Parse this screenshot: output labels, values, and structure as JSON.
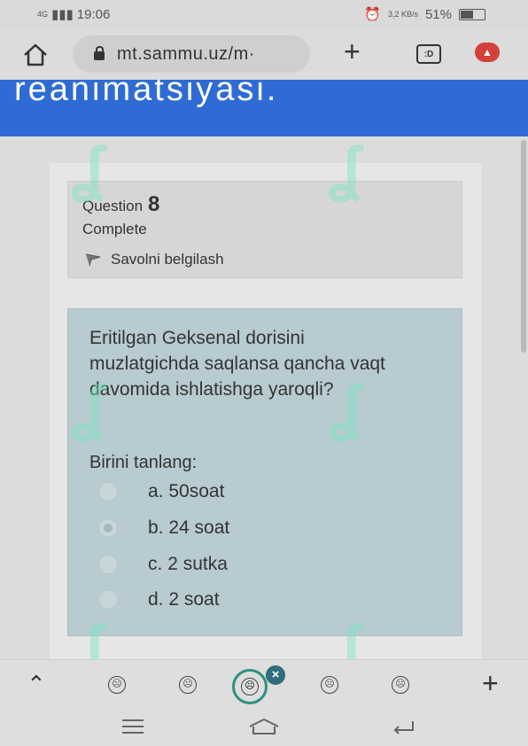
{
  "status_bar": {
    "network": "4G",
    "time": "19:06",
    "speed": "3,2 KB/s",
    "battery": "51%",
    "battery_level": 0.51
  },
  "browser": {
    "url": "mt.sammu.uz/m·",
    "tab_label": ":D"
  },
  "page": {
    "header_text": "reanimatsiyasi."
  },
  "question_info": {
    "label": "Question",
    "number": "8",
    "state": "Complete",
    "flag_label": "Savolni belgilash"
  },
  "question": {
    "text": "Eritilgan Geksenal dorisini muzlatgichda saqlansa qancha vaqt davomida ishlatishga yaroqli?",
    "choose_label": "Birini tanlang:",
    "options": [
      {
        "letter": "a.",
        "label": "50soat"
      },
      {
        "letter": "b.",
        "label": "24 soat"
      },
      {
        "letter": "c.",
        "label": "2 sutka"
      },
      {
        "letter": "d.",
        "label": "2 soat"
      }
    ],
    "selected_index": 1
  },
  "colors": {
    "header_blue": "#2f6bd4",
    "question_bg": "#b7cbd0",
    "active_ring": "#2f8f80"
  }
}
